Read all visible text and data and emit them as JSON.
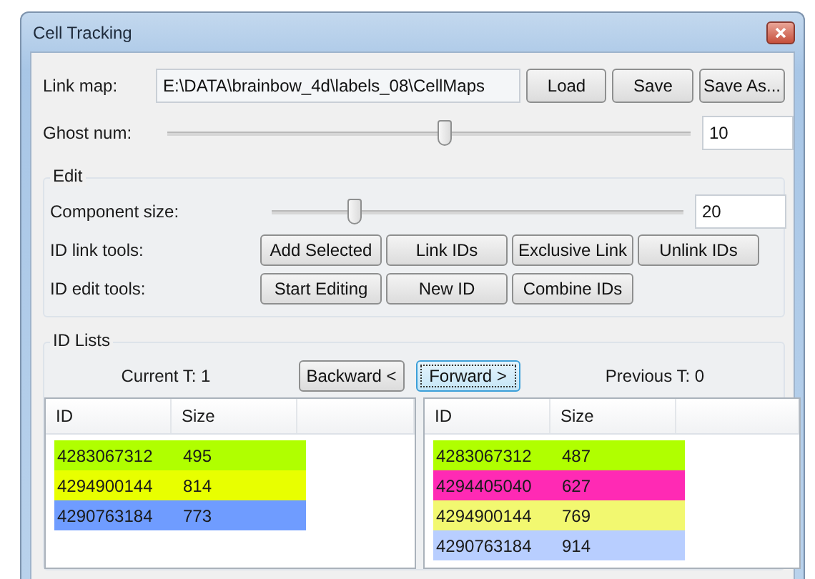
{
  "window": {
    "title": "Cell Tracking"
  },
  "link_map": {
    "label": "Link map:",
    "value": "E:\\DATA\\brainbow_4d\\labels_08\\CellMaps",
    "buttons": [
      "Load",
      "Save",
      "Save As..."
    ]
  },
  "ghost_num": {
    "label": "Ghost num:",
    "level": 0.53,
    "value": "10"
  },
  "edit": {
    "title": "Edit",
    "component_size": {
      "label": "Component size:",
      "level": 0.2,
      "value": "20"
    },
    "tool_rows": [
      {
        "label": "ID link tools:",
        "buttons": [
          "Add Selected",
          "Link IDs",
          "Exclusive Link",
          "Unlink IDs"
        ]
      },
      {
        "label": "ID edit tools:",
        "buttons": [
          "Start Editing",
          "New ID",
          "Combine IDs"
        ]
      }
    ]
  },
  "id_lists": {
    "title": "ID Lists",
    "current_t": "Current T: 1",
    "previous_t": "Previous T: 0",
    "nav_buttons": [
      {
        "label": "Backward <",
        "focused": false
      },
      {
        "label": "Forward >",
        "focused": true
      }
    ],
    "lists": [
      {
        "columns": [
          "ID",
          "Size"
        ],
        "rows": [
          {
            "id": "4283067312",
            "size": "495",
            "color": "#b0ff00"
          },
          {
            "id": "4294900144",
            "size": "814",
            "color": "#e8ff00"
          },
          {
            "id": "4290763184",
            "size": "773",
            "color": "#6f9cff"
          }
        ]
      },
      {
        "columns": [
          "ID",
          "Size"
        ],
        "rows": [
          {
            "id": "4283067312",
            "size": "487",
            "color": "#b0ff00"
          },
          {
            "id": "4294405040",
            "size": "627",
            "color": "#ff2ab4"
          },
          {
            "id": "4294900144",
            "size": "769",
            "color": "#f2f870"
          },
          {
            "id": "4290763184",
            "size": "914",
            "color": "#b8ceff"
          }
        ]
      }
    ]
  }
}
